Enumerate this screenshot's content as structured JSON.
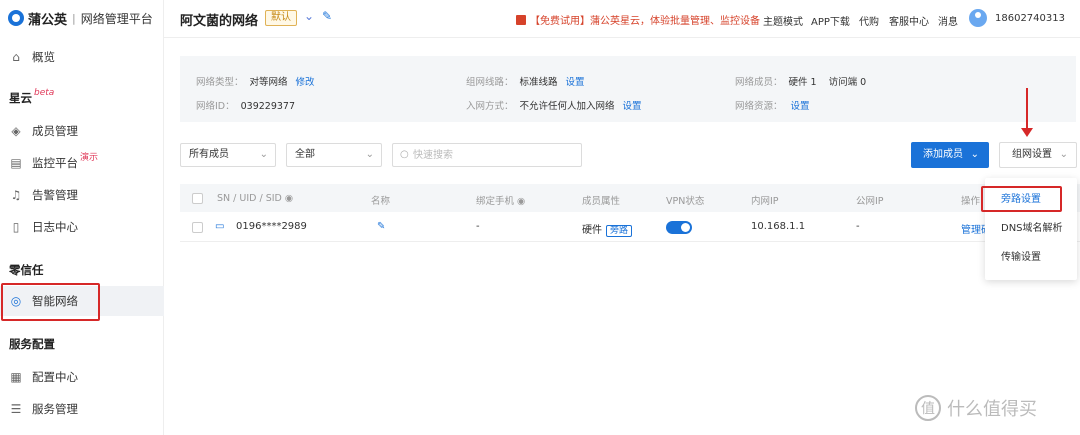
{
  "brand": {
    "name": "蒲公英",
    "product": "网络管理平台"
  },
  "sidebar": {
    "items": [
      {
        "label": "概览",
        "icon": "home-icon"
      },
      {
        "label": "成员管理",
        "icon": "layers-icon"
      },
      {
        "label": "监控平台",
        "icon": "monitor-icon",
        "tag": "演示"
      },
      {
        "label": "告警管理",
        "icon": "bell-icon"
      },
      {
        "label": "日志中心",
        "icon": "document-icon"
      },
      {
        "label": "智能网络",
        "icon": "network-icon",
        "active": true
      },
      {
        "label": "配置中心",
        "icon": "grid-icon"
      },
      {
        "label": "服务管理",
        "icon": "list-icon"
      }
    ],
    "sections": {
      "xingyun": "星云",
      "beta": "beta",
      "zero_trust": "零信任",
      "service_config": "服务配置"
    }
  },
  "topbar": {
    "network_name": "阿文菌的网络",
    "default_badge": "默认",
    "promo": "【免费试用】蒲公英星云，体验批量管理、监控设备",
    "links": [
      "主题模式",
      "APP下载",
      "代购",
      "客服中心",
      "消息"
    ],
    "phone": "18602740313"
  },
  "info": {
    "network_type_label": "网络类型：",
    "network_type": "对等网络",
    "edit": "修改",
    "network_id_label": "网络ID：",
    "network_id": "039229377",
    "route_label": "组网线路：",
    "route": "标准线路",
    "route_set": "设置",
    "join_label": "入网方式：",
    "join": "不允许任何人加入网络",
    "join_set": "设置",
    "members_label": "网络成员：",
    "members": "硬件 1",
    "visitors": "访问端 0",
    "resources_label": "网络资源：",
    "resources_set": "设置"
  },
  "filters": {
    "member_select": "所有成员",
    "all_select": "全部",
    "search_placeholder": "快速搜索",
    "add_member": "添加成员",
    "network_settings": "组网设置"
  },
  "table": {
    "headers": [
      "SN / UID / SID",
      "名称",
      "绑定手机",
      "成员属性",
      "VPN状态",
      "内网IP",
      "公网IP",
      "操作"
    ],
    "rows": [
      {
        "sn": "0196****2989",
        "phone": "-",
        "attr": "硬件",
        "attr_tag": "旁路",
        "vpn": true,
        "lan_ip": "10.168.1.1",
        "wan_ip": "-",
        "action": "管理硬"
      }
    ]
  },
  "menu": {
    "items": [
      "旁路设置",
      "DNS域名解析",
      "传输设置"
    ]
  },
  "watermark": "什么值得买",
  "colors": {
    "primary": "#1a72d8",
    "highlight_red": "#d62828",
    "badge_gold": "#c68a16"
  }
}
